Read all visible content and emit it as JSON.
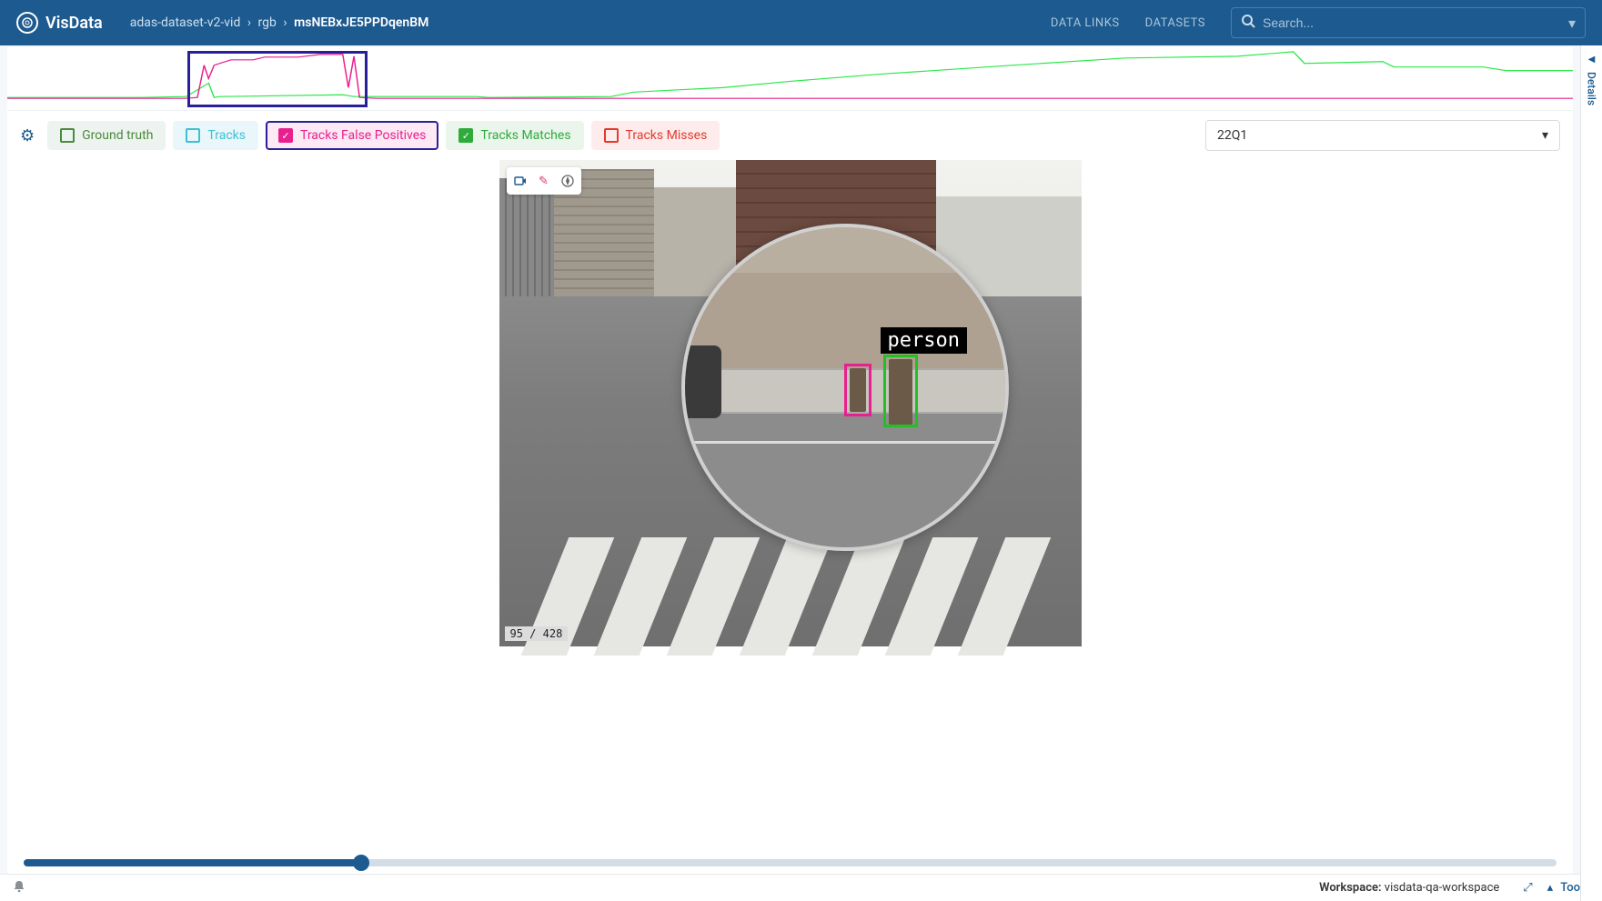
{
  "header": {
    "app_name": "VisData",
    "breadcrumb": {
      "a": "adas-dataset-v2-vid",
      "b": "rgb",
      "c": "msNEBxJE5PPDqenBM"
    },
    "nav": {
      "data_links": "DATA LINKS",
      "datasets": "DATASETS"
    },
    "search_placeholder": "Search..."
  },
  "right_rail": {
    "label": "Details"
  },
  "filters": {
    "ground_truth": "Ground truth",
    "tracks": "Tracks",
    "tracks_fp": "Tracks False Positives",
    "tracks_matches": "Tracks Matches",
    "tracks_misses": "Tracks Misses"
  },
  "dropdown": {
    "selected": "22Q1"
  },
  "frame": {
    "counter": "95 / 428",
    "annotation_label": "person"
  },
  "scrubber": {
    "position_pct": 22
  },
  "footer": {
    "workspace_label": "Workspace:",
    "workspace_name": "visdata-qa-workspace",
    "tools": "Tools"
  }
}
